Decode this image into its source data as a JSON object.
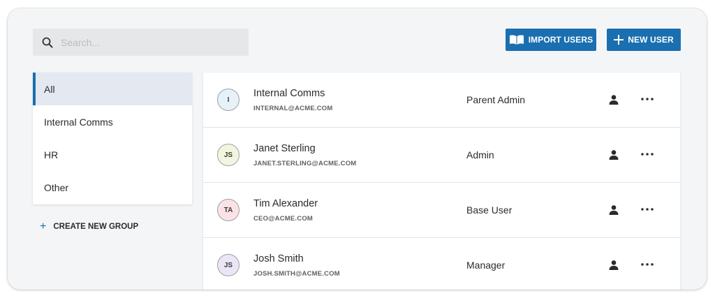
{
  "search": {
    "placeholder": "Search..."
  },
  "toolbar": {
    "import_label": "IMPORT USERS",
    "new_user_label": "NEW USER"
  },
  "groups": {
    "items": [
      {
        "label": "All",
        "active": true
      },
      {
        "label": "Internal Comms",
        "active": false
      },
      {
        "label": "HR",
        "active": false
      },
      {
        "label": "Other",
        "active": false
      }
    ],
    "create_label": "CREATE NEW GROUP"
  },
  "users": [
    {
      "initials": "I",
      "name": "Internal Comms",
      "email": "INTERNAL@ACME.COM",
      "role": "Parent Admin",
      "avatar_bg": "#e6f1f8"
    },
    {
      "initials": "JS",
      "name": "Janet Sterling",
      "email": "JANET.STERLING@ACME.COM",
      "role": "Admin",
      "avatar_bg": "#f2f6df"
    },
    {
      "initials": "TA",
      "name": "Tim Alexander",
      "email": "CEO@ACME.COM",
      "role": "Base User",
      "avatar_bg": "#fbe3e5"
    },
    {
      "initials": "JS",
      "name": "Josh Smith",
      "email": "JOSH.SMITH@ACME.COM",
      "role": "Manager",
      "avatar_bg": "#ece5f6"
    }
  ],
  "colors": {
    "accent": "#1a6fb0",
    "active_bg": "#e4e9f1",
    "panel_bg": "#f4f5f7"
  },
  "icons": {
    "search": "search-icon",
    "import": "book-icon",
    "new_user": "plus-icon",
    "create_group": "plus-icon",
    "user_action": "person-icon",
    "row_menu": "more-icon"
  }
}
